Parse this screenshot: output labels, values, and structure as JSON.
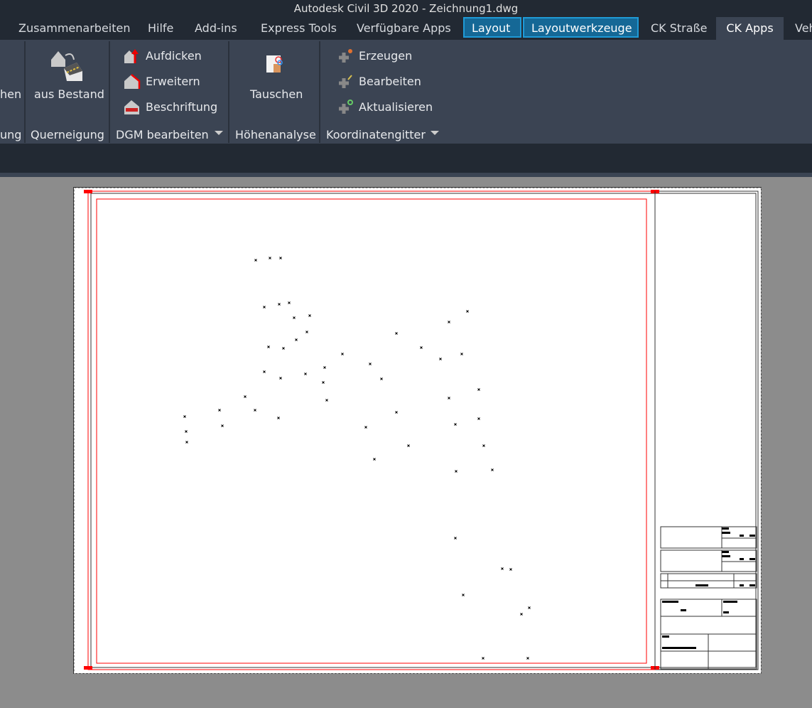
{
  "window": {
    "title": "Autodesk Civil 3D 2020 - Zeichnung1.dwg"
  },
  "tabs": [
    {
      "label": "Zusammenarbeiten"
    },
    {
      "label": "Hilfe"
    },
    {
      "label": "Add-ins"
    },
    {
      "label": "Express Tools"
    },
    {
      "label": "Verfügbare Apps"
    },
    {
      "label": "Layout",
      "state": "highlighted"
    },
    {
      "label": "Layoutwerkzeuge",
      "state": "highlighted"
    },
    {
      "label": "CK Straße"
    },
    {
      "label": "CK Apps",
      "state": "active"
    },
    {
      "label": "Veh"
    }
  ],
  "ribbon": {
    "partial_button": "hen",
    "partial_panel": "ung",
    "querneigung": {
      "button": "aus Bestand",
      "panel": "Querneigung"
    },
    "dgm": {
      "items": [
        "Aufdicken",
        "Erweitern",
        "Beschriftung"
      ],
      "panel": "DGM bearbeiten"
    },
    "hoehen": {
      "button": "Tauschen",
      "panel": "Höhenanalyse"
    },
    "koord": {
      "items": [
        "Erzeugen",
        "Bearbeiten",
        "Aktualisieren"
      ],
      "panel": "Koordinatengitter"
    }
  },
  "colors": {
    "accent": "#156896",
    "frame": "#ff0000",
    "ribbon": "#3b4453",
    "dark": "#222933"
  }
}
